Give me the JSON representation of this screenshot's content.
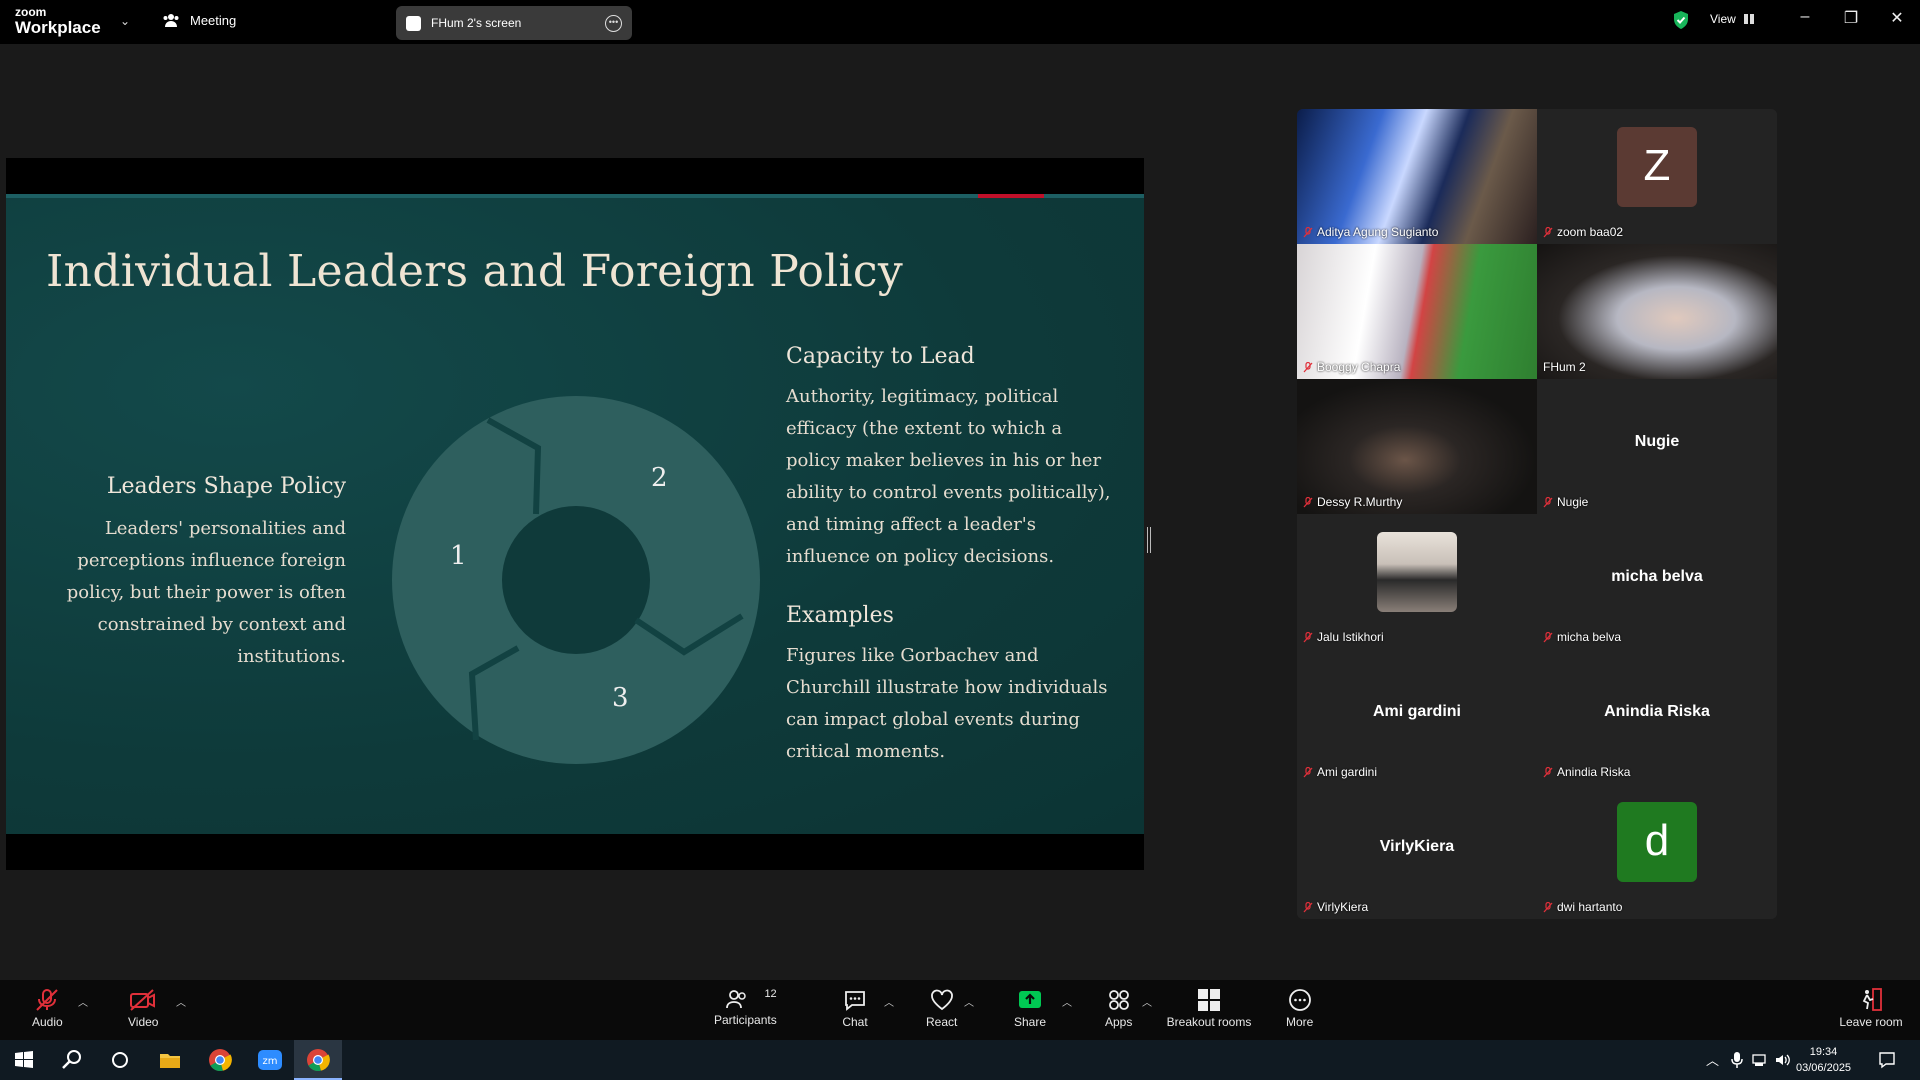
{
  "app": {
    "logo_top": "zoom",
    "logo_bottom": "Workplace",
    "meeting_label": "Meeting",
    "screen_tab_label": "FHum 2's screen",
    "view_label": "View"
  },
  "slide": {
    "title": "Individual Leaders and Foreign Policy",
    "left_heading": "Leaders Shape Policy",
    "left_text": "Leaders' personalities and perceptions influence foreign policy, but their power is often constrained by context and institutions.",
    "cycle_labels": [
      "1",
      "2",
      "3"
    ],
    "right_heading_1": "Capacity to Lead",
    "right_text_1": "Authority, legitimacy, political efficacy (the extent to which a policy maker believes in his or her ability to control events politically), and timing affect a leader's influence on policy decisions.",
    "right_heading_2": "Examples",
    "right_text_2": "Figures like Gorbachev and Churchill illustrate how individuals can impact global events during critical moments."
  },
  "participants": [
    {
      "name": "Aditya Agung Sugianto",
      "type": "video",
      "muted": true
    },
    {
      "name": "zoom baa02",
      "type": "letter",
      "letter": "Z",
      "color": "#5b3a33",
      "muted": true
    },
    {
      "name": "Booggy Chapra",
      "type": "video",
      "muted": true
    },
    {
      "name": "FHum 2",
      "type": "video",
      "muted": false,
      "active": true
    },
    {
      "name": "Dessy R.Murthy",
      "type": "video",
      "muted": true
    },
    {
      "name": "Nugie",
      "display": "Nugie",
      "type": "name",
      "muted": true
    },
    {
      "name": "Jalu Istikhori",
      "type": "photo",
      "muted": true
    },
    {
      "name": "micha belva",
      "display": "micha belva",
      "type": "name",
      "muted": true
    },
    {
      "name": "Ami gardini",
      "display": "Ami gardini",
      "type": "name",
      "muted": true
    },
    {
      "name": "Anindia Riska",
      "display": "Anindia Riska",
      "type": "name",
      "muted": true
    },
    {
      "name": "VirlyKiera",
      "display": "VirlyKiera",
      "type": "name",
      "muted": true
    },
    {
      "name": "dwi hartanto",
      "type": "letter",
      "letter": "d",
      "color": "#1f7a20",
      "muted": true
    }
  ],
  "toolbar": {
    "audio": "Audio",
    "video": "Video",
    "participants": "Participants",
    "participants_count": "12",
    "chat": "Chat",
    "react": "React",
    "share": "Share",
    "apps": "Apps",
    "breakout": "Breakout rooms",
    "more": "More",
    "leave": "Leave room"
  },
  "taskbar": {
    "time": "19:34",
    "date": "03/06/2025"
  },
  "colors": {
    "slide_bg": "#0e3a3a",
    "accent_green": "#00c853",
    "active_border": "#2ed6a0",
    "mute_red": "#e0303a"
  }
}
